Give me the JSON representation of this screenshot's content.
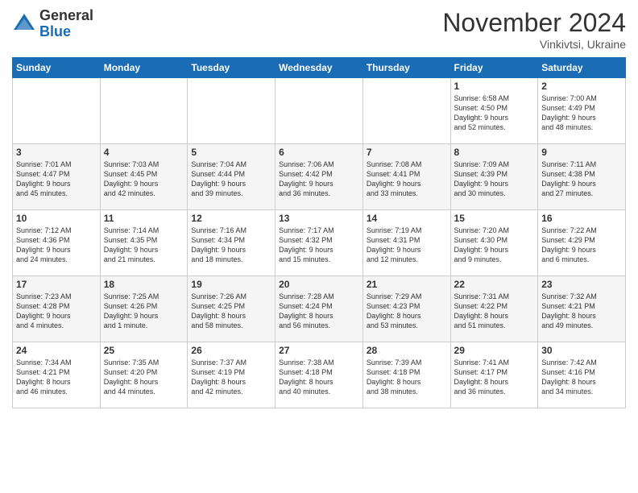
{
  "header": {
    "logo": {
      "line1": "General",
      "line2": "Blue"
    },
    "title": "November 2024",
    "location": "Vinkivtsi, Ukraine"
  },
  "weekdays": [
    "Sunday",
    "Monday",
    "Tuesday",
    "Wednesday",
    "Thursday",
    "Friday",
    "Saturday"
  ],
  "weeks": [
    [
      {
        "day": "",
        "content": ""
      },
      {
        "day": "",
        "content": ""
      },
      {
        "day": "",
        "content": ""
      },
      {
        "day": "",
        "content": ""
      },
      {
        "day": "",
        "content": ""
      },
      {
        "day": "1",
        "content": "Sunrise: 6:58 AM\nSunset: 4:50 PM\nDaylight: 9 hours\nand 52 minutes."
      },
      {
        "day": "2",
        "content": "Sunrise: 7:00 AM\nSunset: 4:49 PM\nDaylight: 9 hours\nand 48 minutes."
      }
    ],
    [
      {
        "day": "3",
        "content": "Sunrise: 7:01 AM\nSunset: 4:47 PM\nDaylight: 9 hours\nand 45 minutes."
      },
      {
        "day": "4",
        "content": "Sunrise: 7:03 AM\nSunset: 4:45 PM\nDaylight: 9 hours\nand 42 minutes."
      },
      {
        "day": "5",
        "content": "Sunrise: 7:04 AM\nSunset: 4:44 PM\nDaylight: 9 hours\nand 39 minutes."
      },
      {
        "day": "6",
        "content": "Sunrise: 7:06 AM\nSunset: 4:42 PM\nDaylight: 9 hours\nand 36 minutes."
      },
      {
        "day": "7",
        "content": "Sunrise: 7:08 AM\nSunset: 4:41 PM\nDaylight: 9 hours\nand 33 minutes."
      },
      {
        "day": "8",
        "content": "Sunrise: 7:09 AM\nSunset: 4:39 PM\nDaylight: 9 hours\nand 30 minutes."
      },
      {
        "day": "9",
        "content": "Sunrise: 7:11 AM\nSunset: 4:38 PM\nDaylight: 9 hours\nand 27 minutes."
      }
    ],
    [
      {
        "day": "10",
        "content": "Sunrise: 7:12 AM\nSunset: 4:36 PM\nDaylight: 9 hours\nand 24 minutes."
      },
      {
        "day": "11",
        "content": "Sunrise: 7:14 AM\nSunset: 4:35 PM\nDaylight: 9 hours\nand 21 minutes."
      },
      {
        "day": "12",
        "content": "Sunrise: 7:16 AM\nSunset: 4:34 PM\nDaylight: 9 hours\nand 18 minutes."
      },
      {
        "day": "13",
        "content": "Sunrise: 7:17 AM\nSunset: 4:32 PM\nDaylight: 9 hours\nand 15 minutes."
      },
      {
        "day": "14",
        "content": "Sunrise: 7:19 AM\nSunset: 4:31 PM\nDaylight: 9 hours\nand 12 minutes."
      },
      {
        "day": "15",
        "content": "Sunrise: 7:20 AM\nSunset: 4:30 PM\nDaylight: 9 hours\nand 9 minutes."
      },
      {
        "day": "16",
        "content": "Sunrise: 7:22 AM\nSunset: 4:29 PM\nDaylight: 9 hours\nand 6 minutes."
      }
    ],
    [
      {
        "day": "17",
        "content": "Sunrise: 7:23 AM\nSunset: 4:28 PM\nDaylight: 9 hours\nand 4 minutes."
      },
      {
        "day": "18",
        "content": "Sunrise: 7:25 AM\nSunset: 4:26 PM\nDaylight: 9 hours\nand 1 minute."
      },
      {
        "day": "19",
        "content": "Sunrise: 7:26 AM\nSunset: 4:25 PM\nDaylight: 8 hours\nand 58 minutes."
      },
      {
        "day": "20",
        "content": "Sunrise: 7:28 AM\nSunset: 4:24 PM\nDaylight: 8 hours\nand 56 minutes."
      },
      {
        "day": "21",
        "content": "Sunrise: 7:29 AM\nSunset: 4:23 PM\nDaylight: 8 hours\nand 53 minutes."
      },
      {
        "day": "22",
        "content": "Sunrise: 7:31 AM\nSunset: 4:22 PM\nDaylight: 8 hours\nand 51 minutes."
      },
      {
        "day": "23",
        "content": "Sunrise: 7:32 AM\nSunset: 4:21 PM\nDaylight: 8 hours\nand 49 minutes."
      }
    ],
    [
      {
        "day": "24",
        "content": "Sunrise: 7:34 AM\nSunset: 4:21 PM\nDaylight: 8 hours\nand 46 minutes."
      },
      {
        "day": "25",
        "content": "Sunrise: 7:35 AM\nSunset: 4:20 PM\nDaylight: 8 hours\nand 44 minutes."
      },
      {
        "day": "26",
        "content": "Sunrise: 7:37 AM\nSunset: 4:19 PM\nDaylight: 8 hours\nand 42 minutes."
      },
      {
        "day": "27",
        "content": "Sunrise: 7:38 AM\nSunset: 4:18 PM\nDaylight: 8 hours\nand 40 minutes."
      },
      {
        "day": "28",
        "content": "Sunrise: 7:39 AM\nSunset: 4:18 PM\nDaylight: 8 hours\nand 38 minutes."
      },
      {
        "day": "29",
        "content": "Sunrise: 7:41 AM\nSunset: 4:17 PM\nDaylight: 8 hours\nand 36 minutes."
      },
      {
        "day": "30",
        "content": "Sunrise: 7:42 AM\nSunset: 4:16 PM\nDaylight: 8 hours\nand 34 minutes."
      }
    ]
  ]
}
